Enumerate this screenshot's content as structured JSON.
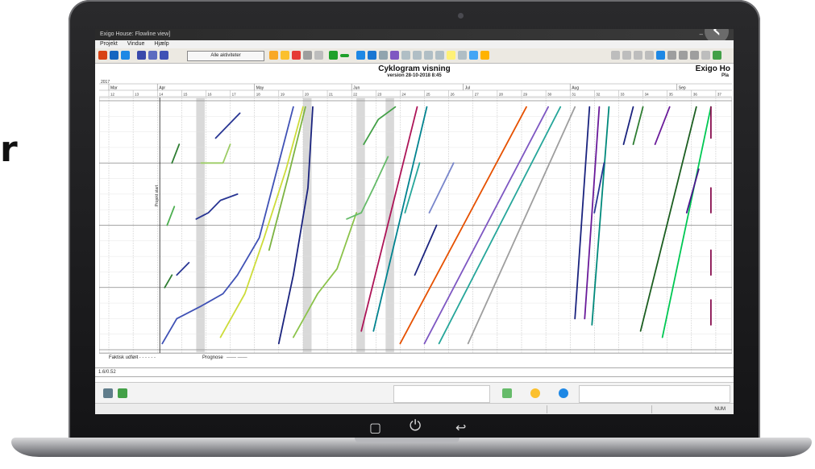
{
  "side_fragment": "r",
  "window": {
    "title": "Exigo House: Flowline view]",
    "minimize_label": "–",
    "back_icon": "chevron-left-icon"
  },
  "menu": {
    "items": [
      "Projekt",
      "Vindue",
      "Hjælp"
    ]
  },
  "toolbar": {
    "activities_button": "Alle aktiviteter",
    "accent_green": "#1fa02b",
    "accent_blue": "#2a6fd1"
  },
  "chart_header": {
    "title": "Cyklogram visning",
    "subtitle": "version 28-10-2018 8:45",
    "brand": "Exigo Ho",
    "brand_sub": "Pla"
  },
  "timeline": {
    "year": "2017",
    "months": [
      "Mar",
      "Apr",
      "May",
      "Jun",
      "Jul",
      "Aug",
      "Sep"
    ],
    "weeks": [
      "12",
      "13",
      "14",
      "15",
      "16",
      "17",
      "18",
      "19",
      "20",
      "21",
      "22",
      "23",
      "24",
      "25",
      "26",
      "27",
      "28",
      "29",
      "30",
      "31",
      "32",
      "33",
      "34",
      "35",
      "36",
      "37"
    ]
  },
  "chart_data": {
    "type": "line",
    "title": "Cyklogram visning",
    "subtitle": "version 28-10-2018 8:45",
    "xlabel": "",
    "ylabel": "",
    "ylim": [
      0,
      4
    ],
    "grid": true,
    "milestone_label": "Projekt start",
    "series": [
      {
        "color": "#2e7d32",
        "x": [
          14.6,
          14.9
        ],
        "y": [
          3.0,
          3.3
        ]
      },
      {
        "color": "#4caf50",
        "x": [
          14.4,
          14.7
        ],
        "y": [
          2.0,
          2.3
        ]
      },
      {
        "color": "#2e7d32",
        "x": [
          14.3,
          14.6
        ],
        "y": [
          1.0,
          1.2
        ]
      },
      {
        "color": "#283593",
        "x": [
          15.6,
          16.1,
          16.6,
          17.3
        ],
        "y": [
          2.1,
          2.2,
          2.4,
          2.5
        ]
      },
      {
        "color": "#283593",
        "x": [
          16.4,
          17.4
        ],
        "y": [
          3.4,
          3.8
        ]
      },
      {
        "color": "#9ccc65",
        "x": [
          15.8,
          16.7,
          17.0
        ],
        "y": [
          3.0,
          3.0,
          3.3
        ]
      },
      {
        "color": "#283593",
        "x": [
          14.8,
          15.3
        ],
        "y": [
          1.2,
          1.4
        ]
      },
      {
        "color": "#3f51b5",
        "x": [
          14.2,
          14.8,
          15.8,
          16.7,
          17.3,
          18.2,
          18.8,
          19.6
        ],
        "y": [
          0.1,
          0.5,
          0.7,
          0.9,
          1.2,
          1.8,
          2.7,
          3.9
        ]
      },
      {
        "color": "#cddc39",
        "x": [
          16.6,
          17.6,
          18.4,
          19.3,
          20.0
        ],
        "y": [
          0.2,
          0.9,
          1.8,
          2.9,
          3.9
        ]
      },
      {
        "color": "#7cb342",
        "x": [
          18.6,
          19.4,
          20.1
        ],
        "y": [
          1.6,
          2.8,
          3.9
        ]
      },
      {
        "color": "#1a237e",
        "x": [
          19.0,
          19.6,
          20.2,
          20.4
        ],
        "y": [
          0.1,
          1.2,
          2.6,
          3.9
        ]
      },
      {
        "color": "#8bc34a",
        "x": [
          19.6,
          20.6,
          21.4,
          22.2
        ],
        "y": [
          0.2,
          0.9,
          1.3,
          2.2
        ]
      },
      {
        "color": "#66bb6a",
        "x": [
          21.8,
          22.4,
          22.9,
          23.5
        ],
        "y": [
          2.1,
          2.2,
          2.6,
          3.1
        ]
      },
      {
        "color": "#43a047",
        "x": [
          22.5,
          23.1,
          23.8
        ],
        "y": [
          3.3,
          3.7,
          3.9
        ]
      },
      {
        "color": "#ad1457",
        "x": [
          22.4,
          24.7
        ],
        "y": [
          0.3,
          3.9
        ]
      },
      {
        "color": "#00838f",
        "x": [
          22.9,
          25.1
        ],
        "y": [
          0.3,
          3.9
        ]
      },
      {
        "color": "#26a69a",
        "x": [
          24.2,
          24.8
        ],
        "y": [
          2.2,
          3.0
        ]
      },
      {
        "color": "#1a237e",
        "x": [
          24.6,
          25.5
        ],
        "y": [
          1.2,
          2.0
        ]
      },
      {
        "color": "#7986cb",
        "x": [
          25.2,
          26.2
        ],
        "y": [
          2.2,
          3.0
        ]
      },
      {
        "color": "#e65100",
        "x": [
          24.0,
          29.2
        ],
        "y": [
          0.1,
          3.9
        ]
      },
      {
        "color": "#7e57c2",
        "x": [
          25.0,
          30.1
        ],
        "y": [
          0.1,
          3.9
        ]
      },
      {
        "color": "#26a69a",
        "x": [
          25.6,
          30.6
        ],
        "y": [
          0.1,
          3.9
        ]
      },
      {
        "color": "#9e9e9e",
        "x": [
          26.8,
          31.2
        ],
        "y": [
          0.1,
          3.9
        ]
      },
      {
        "color": "#1a237e",
        "x": [
          31.2,
          31.8
        ],
        "y": [
          0.5,
          3.9
        ]
      },
      {
        "color": "#6a1b9a",
        "x": [
          31.6,
          32.2
        ],
        "y": [
          0.5,
          3.9
        ]
      },
      {
        "color": "#00897b",
        "x": [
          31.9,
          32.6
        ],
        "y": [
          0.4,
          3.9
        ]
      },
      {
        "color": "#283593",
        "x": [
          32.0,
          32.4
        ],
        "y": [
          2.2,
          3.0
        ]
      },
      {
        "color": "#1a237e",
        "x": [
          33.2,
          33.6
        ],
        "y": [
          3.3,
          3.9
        ]
      },
      {
        "color": "#2e7d32",
        "x": [
          33.6,
          34.0
        ],
        "y": [
          3.3,
          3.9
        ]
      },
      {
        "color": "#6a1b9a",
        "x": [
          34.5,
          35.1
        ],
        "y": [
          3.3,
          3.9
        ]
      },
      {
        "color": "#1b5e20",
        "x": [
          33.9,
          36.2
        ],
        "y": [
          0.3,
          3.9
        ]
      },
      {
        "color": "#00c853",
        "x": [
          34.8,
          36.8
        ],
        "y": [
          0.2,
          3.9
        ]
      },
      {
        "color": "#4a148c",
        "x": [
          35.8,
          36.3
        ],
        "y": [
          2.2,
          2.9
        ]
      },
      {
        "color": "#880e4f",
        "x": [
          36.8,
          36.8
        ],
        "y": [
          3.4,
          3.9
        ]
      },
      {
        "color": "#880e4f",
        "x": [
          36.8,
          36.8
        ],
        "y": [
          2.2,
          2.6
        ]
      },
      {
        "color": "#880e4f",
        "x": [
          36.8,
          36.8
        ],
        "y": [
          1.2,
          1.6
        ]
      },
      {
        "color": "#880e4f",
        "x": [
          36.8,
          36.8
        ],
        "y": [
          0.4,
          0.8
        ]
      }
    ],
    "legend": [
      "Faktisk udført",
      "Prognose"
    ]
  },
  "statusline": "1.6/0.52",
  "statusbar": {
    "num": "NUM"
  }
}
